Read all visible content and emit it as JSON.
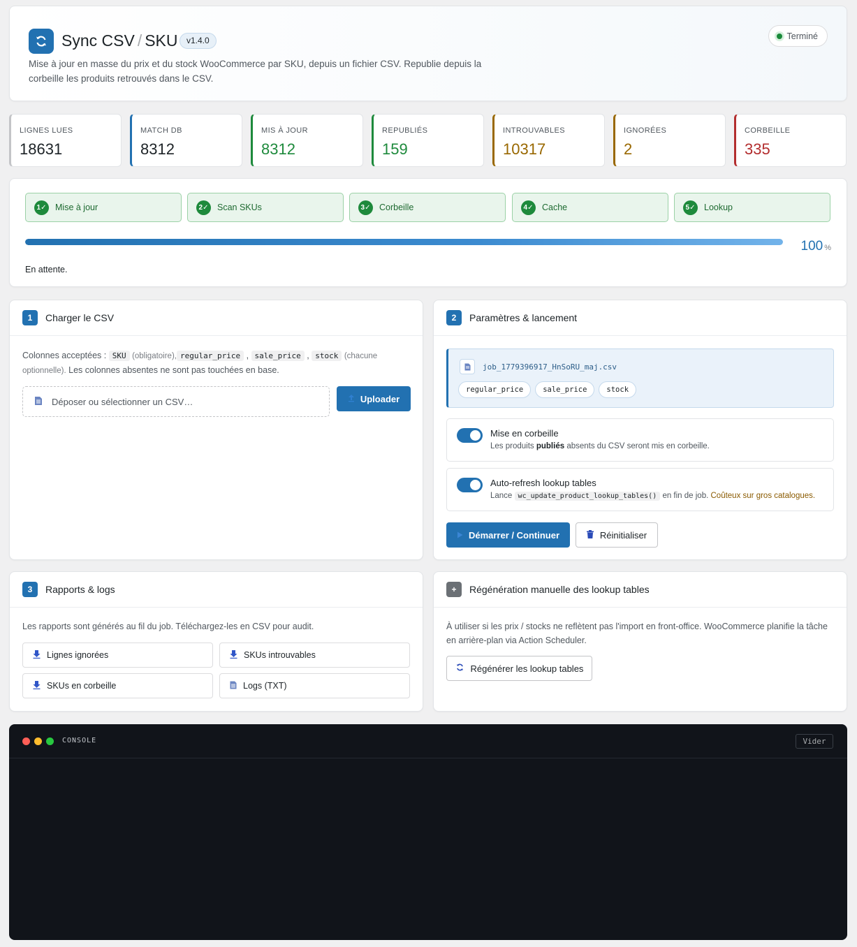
{
  "header": {
    "title_main": "Sync CSV",
    "title_sep": "/",
    "title_sub": "SKU",
    "version": "v1.4.0",
    "subtitle": "Mise à jour en masse du prix et du stock WooCommerce par SKU, depuis un fichier CSV. Republie depuis la corbeille les produits retrouvés dans le CSV.",
    "status": "Terminé",
    "status_color": "#1a8a3a"
  },
  "stats": [
    {
      "label": "LIGNES LUES",
      "value": "18631",
      "color": "#1d2327",
      "border": "#c3c4c7"
    },
    {
      "label": "MATCH DB",
      "value": "8312",
      "color": "#1d2327",
      "border": "#2271b1"
    },
    {
      "label": "MIS À JOUR",
      "value": "8312",
      "color": "#1e8a3c",
      "border": "#1e8a3c"
    },
    {
      "label": "REPUBLIÉS",
      "value": "159",
      "color": "#1e8a3c",
      "border": "#1e8a3c"
    },
    {
      "label": "INTROUVABLES",
      "value": "10317",
      "color": "#996800",
      "border": "#996800"
    },
    {
      "label": "IGNORÉES",
      "value": "2",
      "color": "#996800",
      "border": "#996800"
    },
    {
      "label": "CORBEILLE",
      "value": "335",
      "color": "#b32d2e",
      "border": "#b32d2e"
    }
  ],
  "steps": [
    {
      "num": "1",
      "label": "Mise à jour"
    },
    {
      "num": "2",
      "label": "Scan SKUs"
    },
    {
      "num": "3",
      "label": "Corbeille"
    },
    {
      "num": "4",
      "label": "Cache"
    },
    {
      "num": "5",
      "label": "Lookup"
    }
  ],
  "progress": {
    "percent": 100,
    "percent_text": "100",
    "unit": "%",
    "status_text": "En attente."
  },
  "panel_csv": {
    "num": "1",
    "title": "Charger le CSV",
    "accepted_prefix": "Colonnes acceptées :",
    "col_sku": "SKU",
    "sku_note": "(obligatoire),",
    "col_regular": "regular_price",
    "comma1": ",",
    "col_sale": "sale_price",
    "comma2": ",",
    "col_stock": "stock",
    "optional_note": "(chacune optionnelle).",
    "absent_note": "Les colonnes absentes ne sont pas touchées en base.",
    "drop_placeholder": "Déposer ou sélectionner un CSV…",
    "upload_label": "Uploader"
  },
  "panel_params": {
    "num": "2",
    "title": "Paramètres & lancement",
    "file_name": "job_1779396917_HnSoRU_maj.csv",
    "chips": [
      "regular_price",
      "sale_price",
      "stock"
    ],
    "trash_title": "Mise en corbeille",
    "trash_desc_pre": "Les produits",
    "trash_desc_bold": "publiés",
    "trash_desc_post": "absents du CSV seront mis en corbeille.",
    "lookup_title": "Auto-refresh lookup tables",
    "lookup_desc_pre": "Lance",
    "lookup_code": "wc_update_product_lookup_tables()",
    "lookup_desc_mid": "en fin de job.",
    "lookup_warn": "Coûteux sur gros catalogues.",
    "start_label": "Démarrer / Continuer",
    "reset_label": "Réinitialiser"
  },
  "panel_reports": {
    "num": "3",
    "title": "Rapports & logs",
    "desc": "Les rapports sont générés au fil du job. Téléchargez-les en CSV pour audit.",
    "buttons": [
      "Lignes ignorées",
      "SKUs introuvables",
      "SKUs en corbeille",
      "Logs (TXT)"
    ]
  },
  "panel_regen": {
    "num": "+",
    "title": "Régénération manuelle des lookup tables",
    "desc": "À utiliser si les prix / stocks ne reflètent pas l'import en front-office. WooCommerce planifie la tâche en arrière-plan via Action Scheduler.",
    "button": "Régénérer les lookup tables"
  },
  "console": {
    "title": "CONSOLE",
    "clear": "Vider"
  }
}
